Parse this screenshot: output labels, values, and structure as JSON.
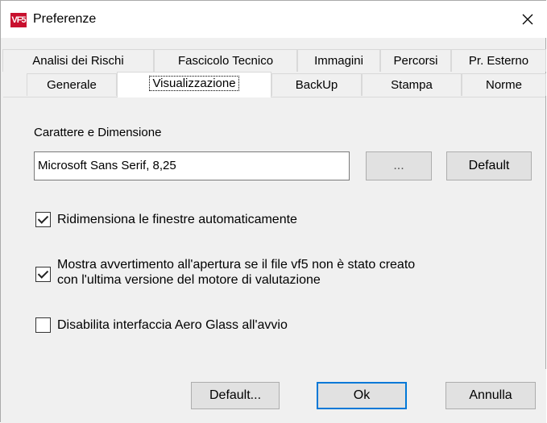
{
  "window": {
    "title": "Preferenze",
    "app_icon_text": "VF5"
  },
  "tabs": {
    "row1": [
      "Analisi dei Rischi",
      "Fascicolo Tecnico",
      "Immagini",
      "Percorsi",
      "Pr. Esterno"
    ],
    "row2": [
      "Generale",
      "Visualizzazione",
      "BackUp",
      "Stampa",
      "Norme"
    ],
    "active": "Visualizzazione"
  },
  "font_section": {
    "label": "Carattere e Dimensione",
    "value": "Microsoft Sans Serif, 8,25",
    "browse_label": "...",
    "default_label": "Default"
  },
  "options": [
    {
      "label": "Ridimensiona le finestre automaticamente",
      "checked": true
    },
    {
      "label_line1": "Mostra avvertimento all'apertura se il file vf5 non è stato creato",
      "label_line2": "con l'ultima versione del motore di valutazione",
      "checked": true
    },
    {
      "label": "Disabilita interfaccia Aero Glass all'avvio",
      "checked": false
    }
  ],
  "footer": {
    "default_label": "Default...",
    "ok_label": "Ok",
    "cancel_label": "Annulla"
  },
  "colors": {
    "accent": "#0078d7",
    "app_icon": "#c8102e"
  }
}
